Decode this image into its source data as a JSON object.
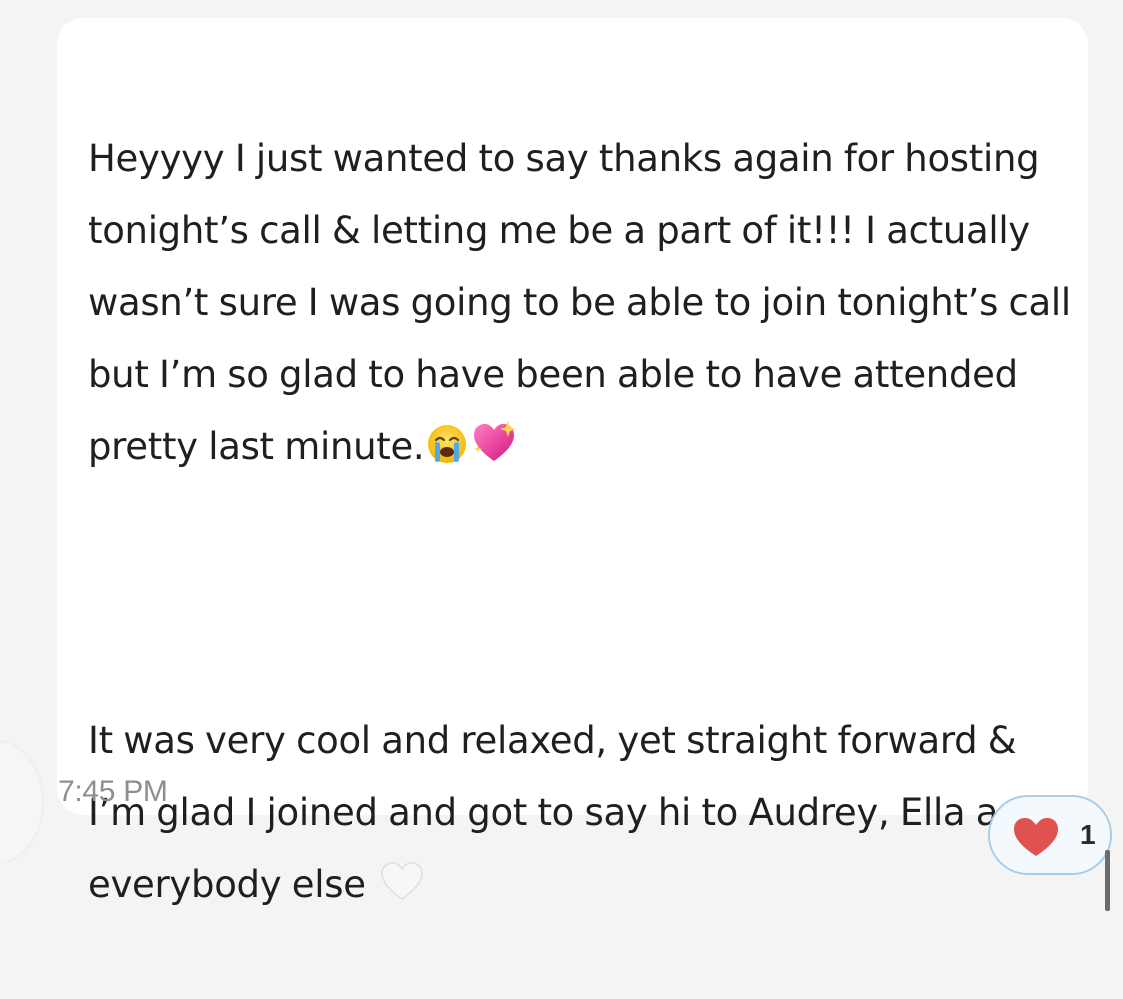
{
  "message": {
    "paragraph_1": "Heyyyy I just wanted to say thanks again for hosting tonight’s call & letting me be a part of it!!! I actually wasn’t sure I was going to be able to join tonight’s call but I’m so glad to have been able to have attended pretty last minute.",
    "paragraph_1_emojis": [
      "loudly-crying-face",
      "sparkling-heart"
    ],
    "paragraph_2": " It was very cool and relaxed, yet straight forward & I’m glad I joined and got to say hi to Audrey, Ella and everybody else",
    "paragraph_2_emoji": "white-heart",
    "timestamp": "7:45 PM"
  },
  "reaction": {
    "icon": "red-heart",
    "count": "1"
  },
  "colors": {
    "background": "#f4f4f4",
    "bubble": "#ffffff",
    "text": "#1f1f1f",
    "timestamp": "#8e8e8e",
    "reaction_border": "#a9cde8",
    "heart": "#e0524f"
  }
}
